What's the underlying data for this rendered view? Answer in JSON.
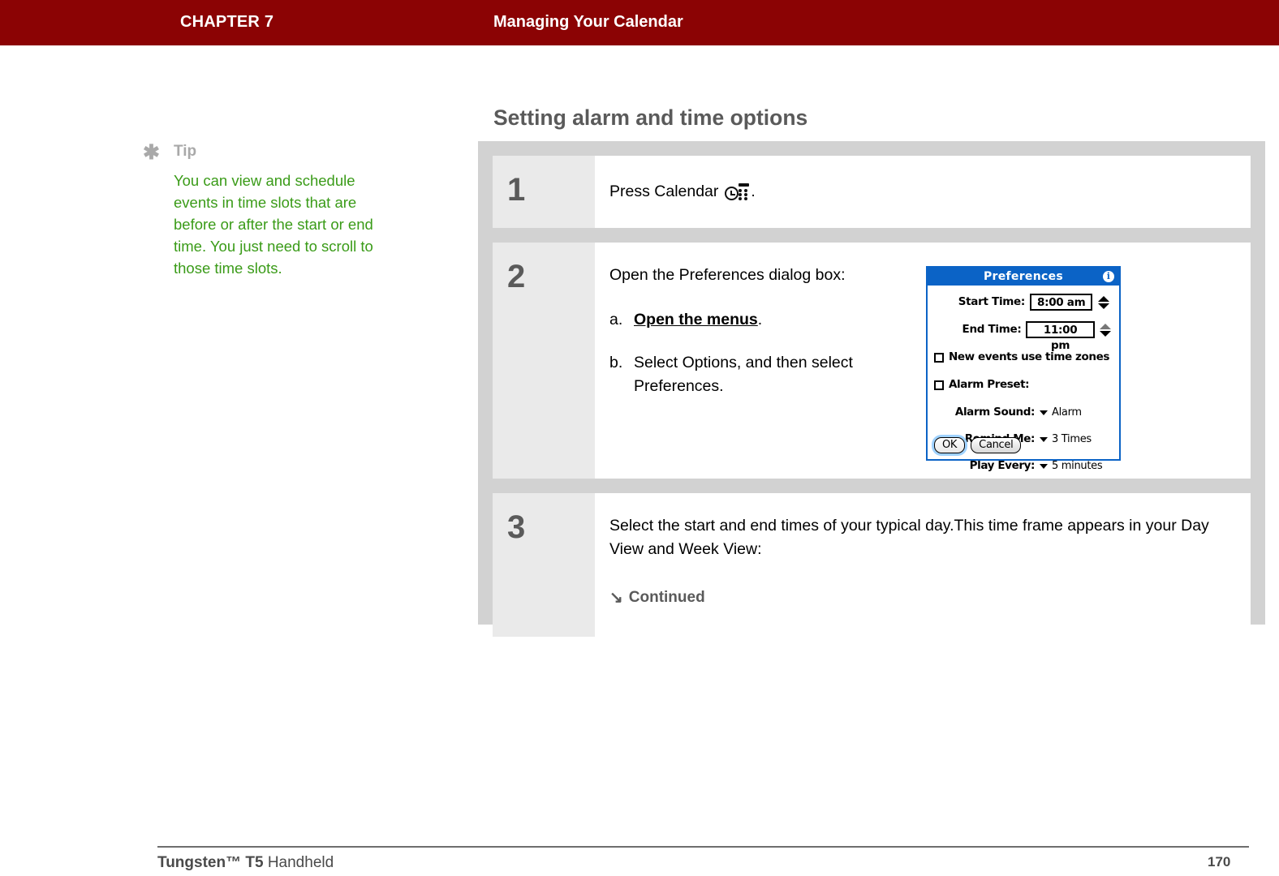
{
  "header": {
    "chapter": "CHAPTER 7",
    "chapter_title": "Managing Your Calendar",
    "bar_color": "#8b0304"
  },
  "tip": {
    "icon": "asterisk-icon",
    "label": "Tip",
    "body": "You can view and schedule events in time slots that are before or after the start or end time. You just need to scroll to those time slots.",
    "text_color": "#3a9b18",
    "label_color": "#a9a9a9"
  },
  "section": {
    "heading": "Setting alarm and time options"
  },
  "steps": [
    {
      "number": "1",
      "text_before_icon": "Press Calendar",
      "icon": "calendar-button-icon",
      "text_after_icon": "."
    },
    {
      "number": "2",
      "lead": "Open the Preferences dialog box:",
      "substeps": [
        {
          "marker": "a.",
          "link_text": "Open the menus",
          "trailing": "."
        },
        {
          "marker": "b.",
          "text": "Select Options, and then select Preferences."
        }
      ]
    },
    {
      "number": "3",
      "text": "Select the start and end times of your typical day.This time frame appears in your Day View and Week View:",
      "continued_label": "Continued",
      "continued_arrow": "↘"
    }
  ],
  "dialog": {
    "title": "Preferences",
    "info_icon": "info-icon",
    "info_glyph": "i",
    "title_bar_color": "#0b63c6",
    "fields": [
      {
        "label": "Start Time:",
        "value": "8:00 am"
      },
      {
        "label": "End Time:",
        "value": "11:00 pm"
      }
    ],
    "checkboxes": [
      {
        "label": "New events use time zones",
        "checked": false
      },
      {
        "label": "Alarm Preset:",
        "checked": false
      }
    ],
    "dropdowns": [
      {
        "label": "Alarm Sound:",
        "value": "Alarm"
      },
      {
        "label": "Remind Me:",
        "value": "3 Times"
      },
      {
        "label": "Play Every:",
        "value": "5 minutes"
      }
    ],
    "buttons": {
      "ok": "OK",
      "cancel": "Cancel"
    }
  },
  "footer": {
    "product_bold": "Tungsten™ T5",
    "product_rest": " Handheld",
    "page_number": "170"
  }
}
